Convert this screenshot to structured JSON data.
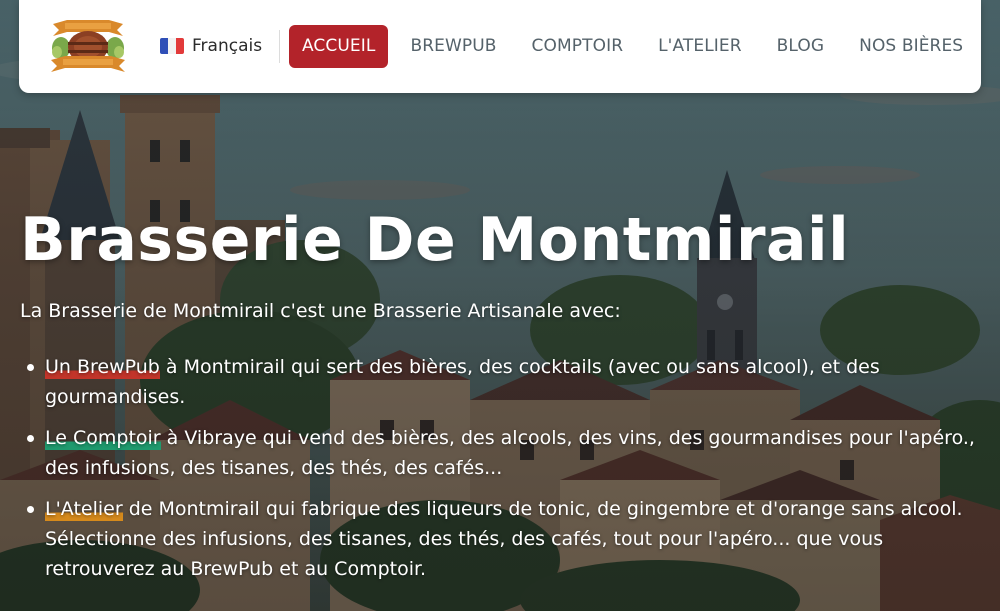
{
  "header": {
    "logo_icon": "brasserie-barrel-logo",
    "language": {
      "flag_icon": "france-flag-icon",
      "label": "Français"
    },
    "nav": [
      {
        "label": "ACCUEIL",
        "active": true
      },
      {
        "label": "BREWPUB",
        "active": false
      },
      {
        "label": "COMPTOIR",
        "active": false
      },
      {
        "label": "L'ATELIER",
        "active": false
      },
      {
        "label": "BLOG",
        "active": false
      },
      {
        "label": "NOS BIÈRES",
        "active": false
      }
    ],
    "active_color": "#b3232a"
  },
  "hero": {
    "title": "Brasserie De Montmirail",
    "intro": "La Brasserie de Montmirail c'est une Brasserie Artisanale avec:",
    "items": [
      {
        "link": "Un BrewPub",
        "link_color": "#c2352a",
        "text": " à Montmirail qui sert des bières, des cocktails (avec ou sans alcool), et des gourmandises."
      },
      {
        "link": "Le Comptoir",
        "link_color": "#1f9a6e",
        "text": " à Vibraye qui vend des bières, des alcools, des vins, des gourmandises pour l'apéro., des infusions, des tisanes, des thés, des cafés..."
      },
      {
        "link": "L'Atelier",
        "link_color": "#d68a1c",
        "text": " de Montmirail qui fabrique des liqueurs de tonic, de gingembre et d'orange sans alcool. Sélectionne des infusions, des tisanes, des thés, des cafés, tout pour l'apéro... que vous retrouverez au BrewPub et au Comptoir."
      }
    ]
  }
}
